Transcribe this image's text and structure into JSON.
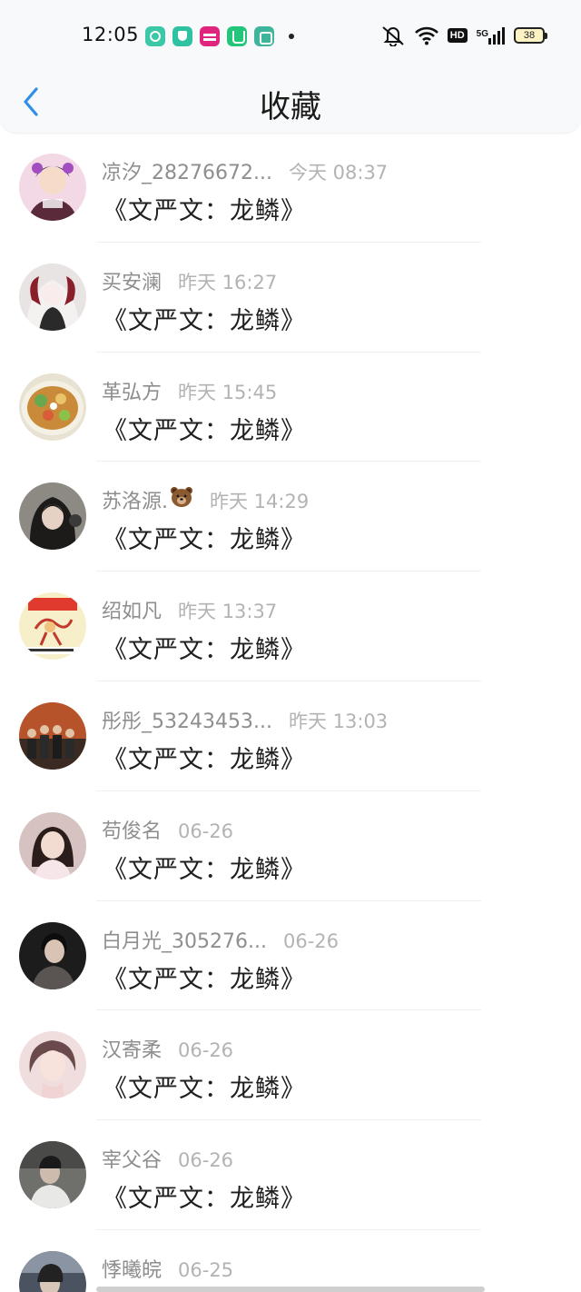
{
  "status_bar": {
    "time": "12:05",
    "hd": "HD",
    "network": "5G",
    "battery": "38"
  },
  "nav": {
    "title": "收藏"
  },
  "items": [
    {
      "name": "凉汐_28276672...",
      "time": "今天 08:37",
      "content": "《文严文：龙鳞》",
      "avatar_color": "#f3d9e6"
    },
    {
      "name": "买安澜",
      "time": "昨天 16:27",
      "content": "《文严文：龙鳞》",
      "avatar_color": "#e9e4e4"
    },
    {
      "name": "革弘方",
      "time": "昨天 15:45",
      "content": "《文严文：龙鳞》",
      "avatar_color": "#c9a46a"
    },
    {
      "name": "苏洛源.",
      "emoji": "bear",
      "time": "昨天 14:29",
      "content": "《文严文：龙鳞》",
      "avatar_color": "#8d8a84"
    },
    {
      "name": "绍如凡",
      "time": "昨天 13:37",
      "content": "《文严文：龙鳞》",
      "avatar_color": "#f6efc9"
    },
    {
      "name": "彤彤_53243453...",
      "time": "昨天 13:03",
      "content": "《文严文：龙鳞》",
      "avatar_color": "#b7532a"
    },
    {
      "name": "苟俊名",
      "time": "06-26",
      "content": "《文严文：龙鳞》",
      "avatar_color": "#d6c2c0"
    },
    {
      "name": "白月光_305276...",
      "time": "06-26",
      "content": "《文严文：龙鳞》",
      "avatar_color": "#1c1c1c"
    },
    {
      "name": "汉寄柔",
      "time": "06-26",
      "content": "《文严文：龙鳞》",
      "avatar_color": "#f0dede"
    },
    {
      "name": "宰父谷",
      "time": "06-26",
      "content": "《文严文：龙鳞》",
      "avatar_color": "#6f6f6c"
    },
    {
      "name": "悸曦皖",
      "time": "06-25",
      "content": "",
      "avatar_color": "#4b5360"
    }
  ],
  "colors": {
    "accent": "#2f8fe8",
    "name_text": "#8e8e8e",
    "time_text": "#b3b3b3",
    "content_text": "#1f1f1f"
  }
}
